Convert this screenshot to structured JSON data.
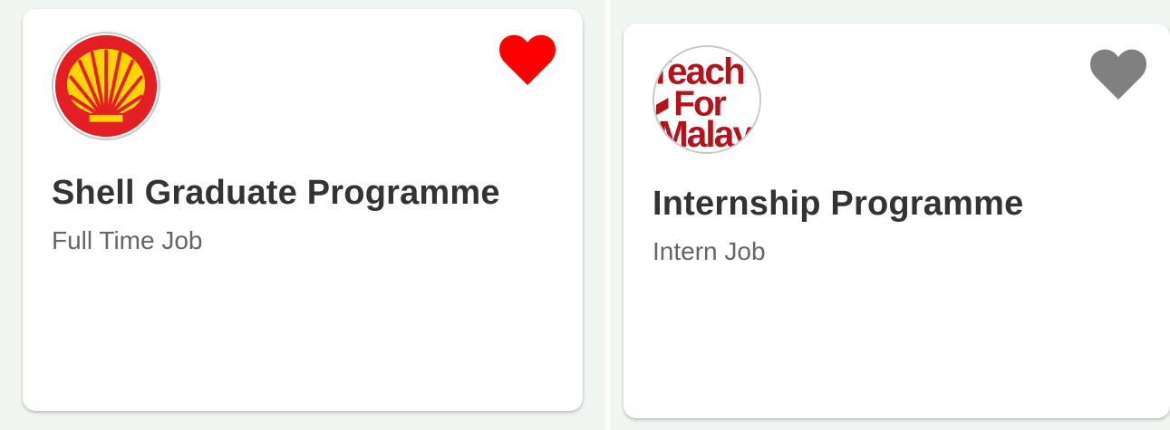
{
  "colors": {
    "background": "#f1f6f2",
    "card": "#ffffff",
    "title": "#333333",
    "subtitle": "#666666",
    "heart_favorited": "#ff0000",
    "heart_default": "#808080"
  },
  "jobs": [
    {
      "company_logo": "shell-logo",
      "title": "Shell Graduate Programme",
      "job_type": "Full Time Job",
      "favorited": true,
      "heart_icon": "heart-filled-red"
    },
    {
      "company_logo": "teach-for-malaysia-logo",
      "logo_text_lines": [
        "Teach",
        "For",
        "Malaysia"
      ],
      "title": "Internship Programme",
      "job_type": "Intern Job",
      "favorited": false,
      "heart_icon": "heart-filled-grey"
    }
  ]
}
